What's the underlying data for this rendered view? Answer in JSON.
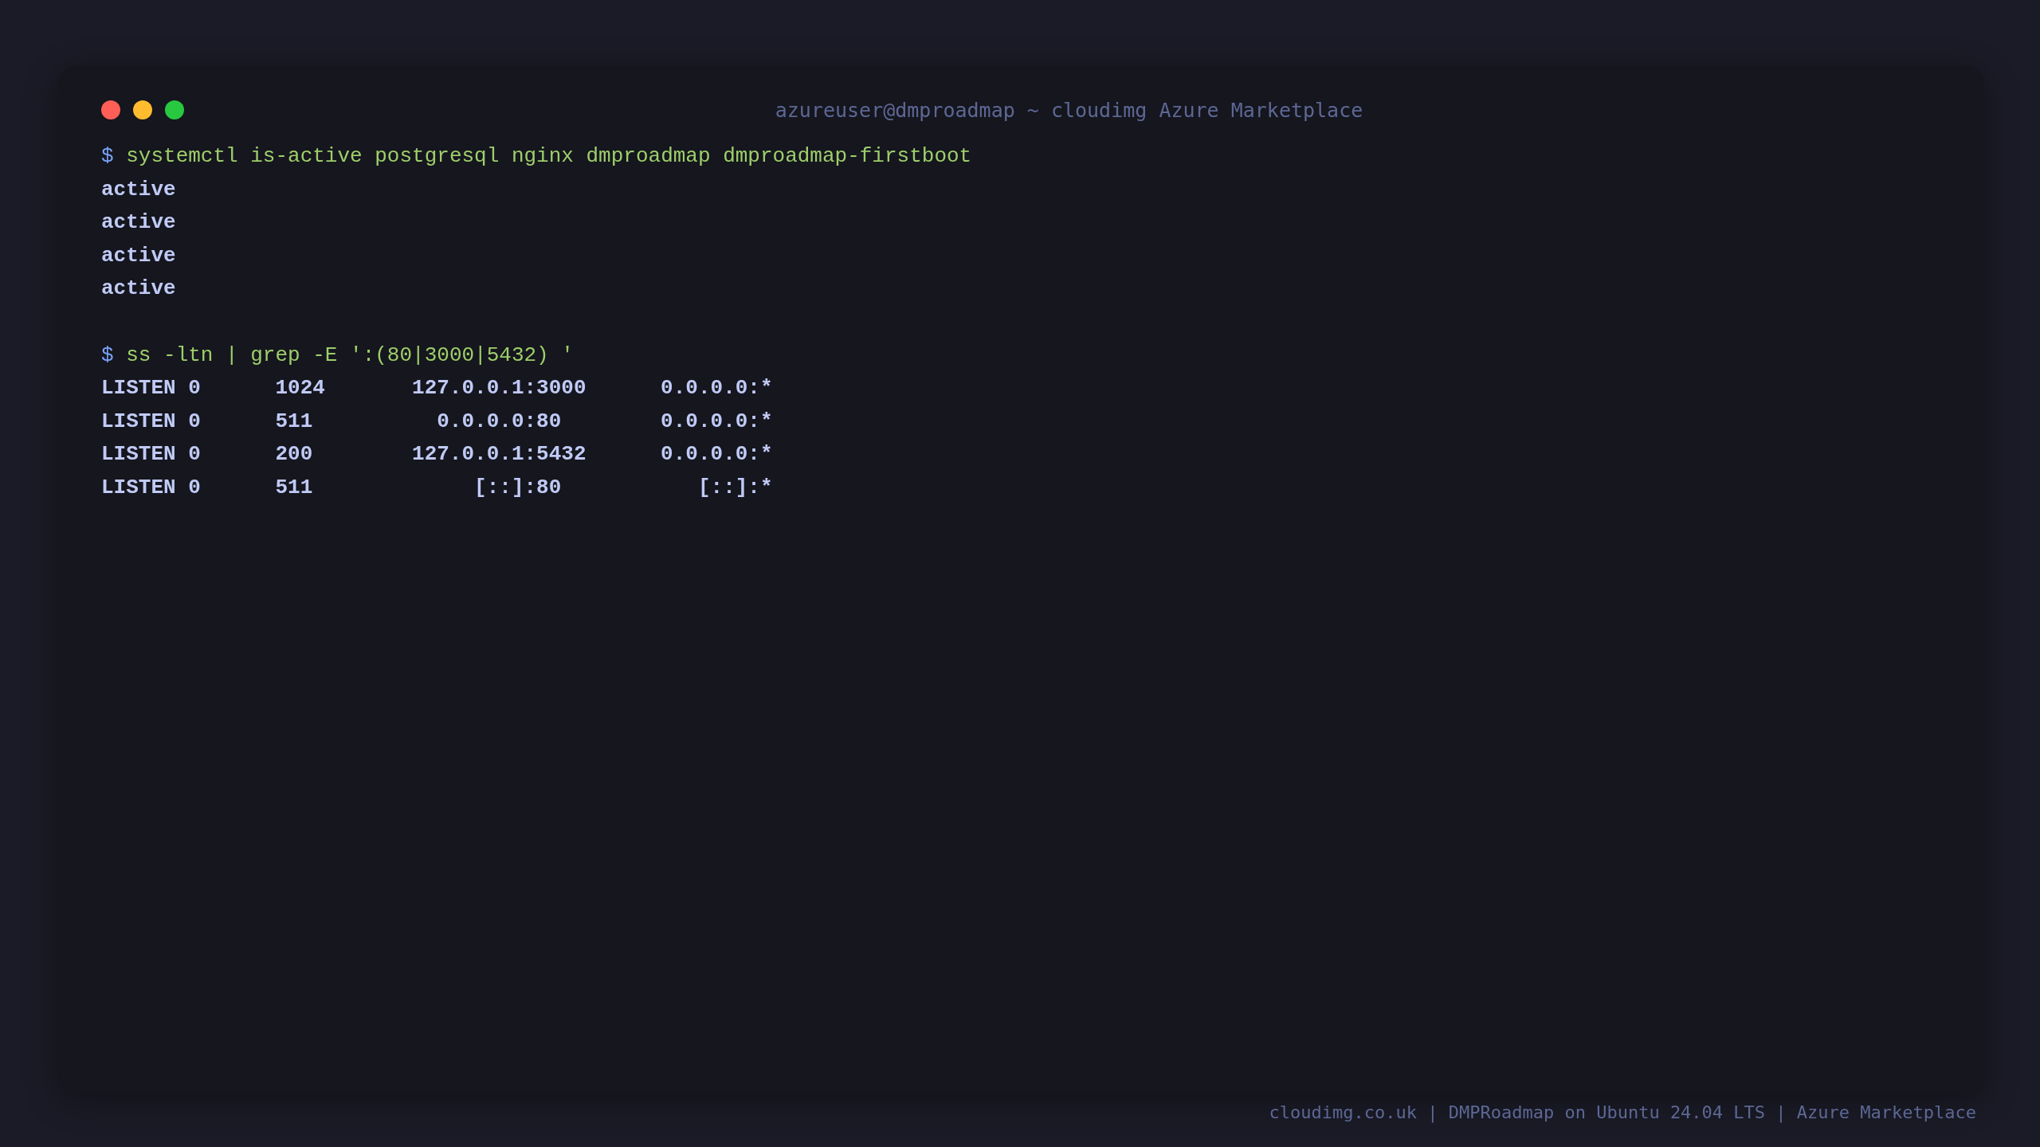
{
  "window": {
    "title": "azureuser@dmproadmap ~ cloudimg Azure Marketplace"
  },
  "blocks": [
    {
      "prompt": "$",
      "command": "systemctl is-active postgresql nginx dmproadmap dmproadmap-firstboot",
      "output": [
        "active",
        "active",
        "active",
        "active"
      ]
    },
    {
      "prompt": "$",
      "command": "ss -ltn | grep -E ':(80|3000|5432) '",
      "output": [
        "LISTEN 0      1024       127.0.0.1:3000      0.0.0.0:*",
        "LISTEN 0      511          0.0.0.0:80        0.0.0.0:*",
        "LISTEN 0      200        127.0.0.1:5432      0.0.0.0:*",
        "LISTEN 0      511             [::]:80           [::]:*"
      ]
    }
  ],
  "footer": "cloudimg.co.uk | DMPRoadmap on Ubuntu 24.04 LTS | Azure Marketplace"
}
